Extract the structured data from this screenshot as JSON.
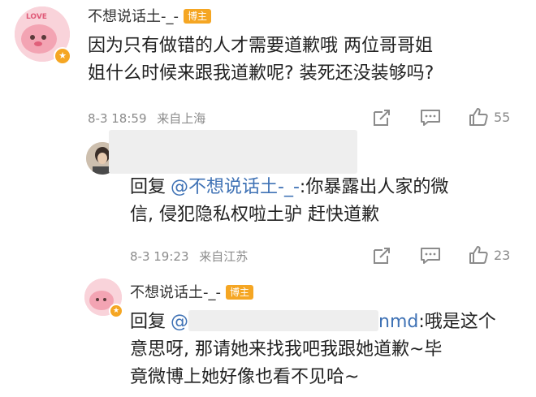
{
  "comment": {
    "author": "不想说话土-_-",
    "badge": "博主",
    "avatar_text": "LOVE",
    "text_line1": "因为只有做错的人才需要道歉哦 两位哥哥姐",
    "text_line2": "姐什么时候来跟我道歉呢? 装死还没装够吗?",
    "date": "8-3 18:59",
    "location": "来自上海",
    "like_count": "55"
  },
  "reply1": {
    "reply_word": "回复",
    "mention": "@不想说话土-_-",
    "text_after_mention": ":你暴露出人家的微",
    "text_line2": "信, 侵犯隐私权啦土驴 赶快道歉",
    "date": "8-3 19:23",
    "location": "来自江苏",
    "like_count": "23"
  },
  "reply2": {
    "author": "不想说话土-_-",
    "badge": "博主",
    "reply_word": "回复",
    "mention_prefix": "@",
    "mention_suffix": "nmd",
    "text_after_mention": ":哦是这个",
    "text_line2": "意思呀, 那请她来找我吧我跟她道歉~毕",
    "text_line3": "竟微博上她好像也看不见哈~"
  },
  "colors": {
    "mention": "#3f72b5",
    "badge": "#f5a623",
    "avatar_pink": "#f6b6c0",
    "meta_gray": "#8b8b8b"
  },
  "icons": [
    "share-icon",
    "comment-icon",
    "like-icon",
    "avatar-star-badge-icon"
  ]
}
